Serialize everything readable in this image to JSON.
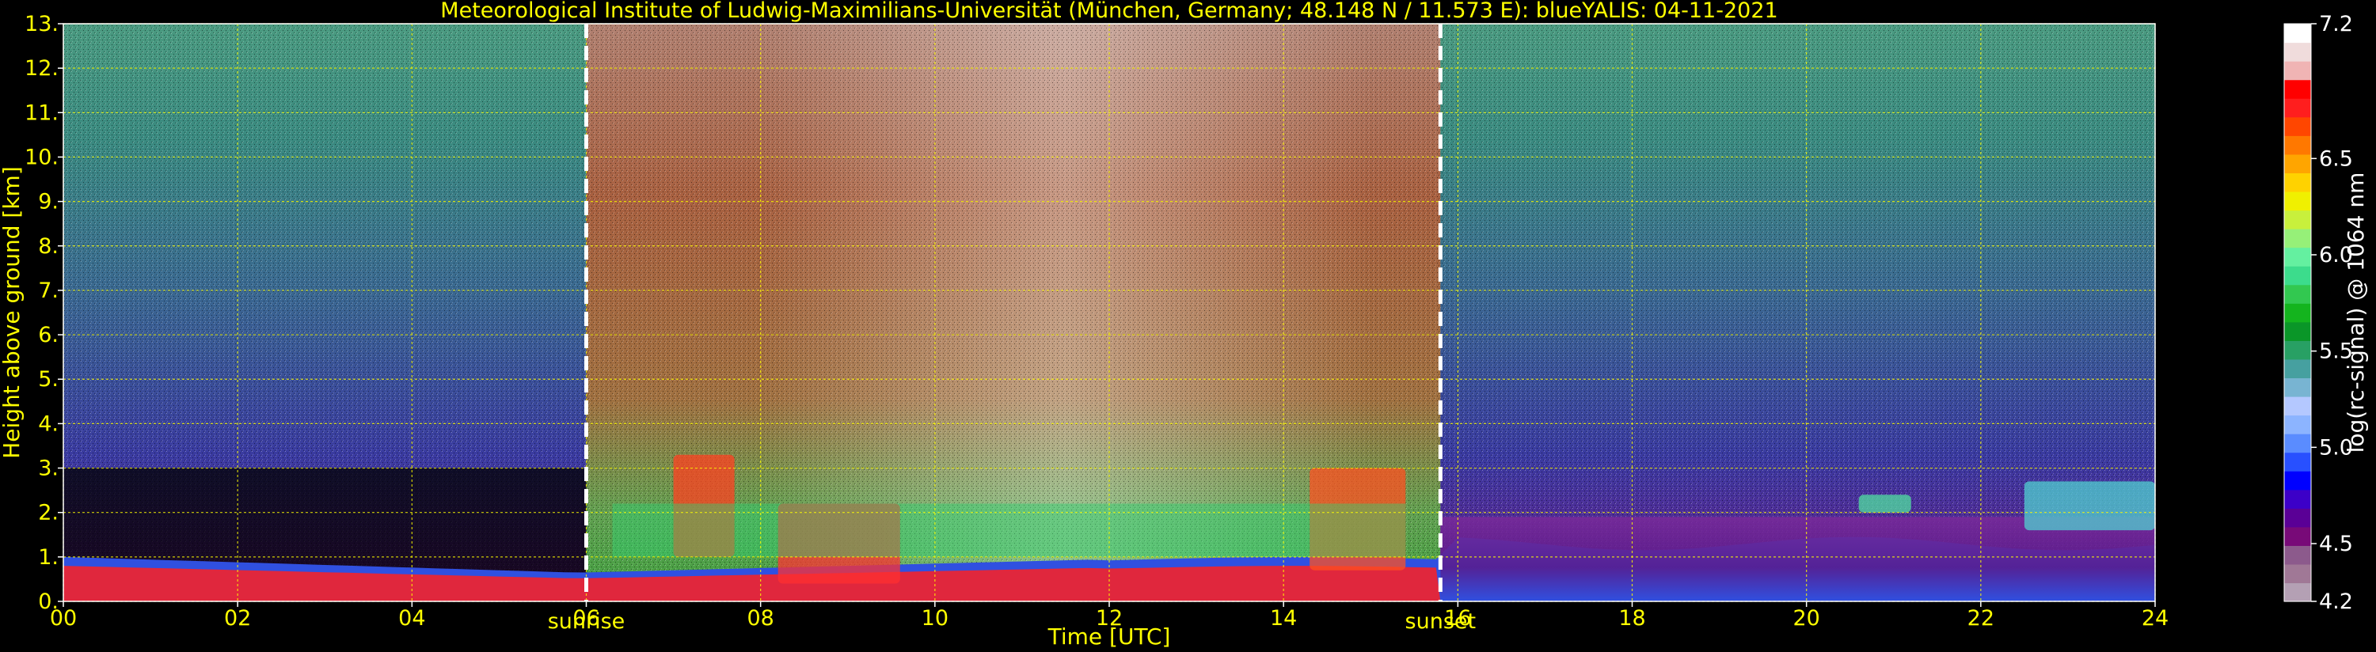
{
  "chart_data": {
    "type": "heatmap",
    "title": "Meteorological Institute of Ludwig-Maximilians-Universität (München, Germany; 48.148 N / 11.573 E):    blueYALIS: 04-11-2021",
    "xlabel": "Time [UTC]",
    "ylabel": "Height above ground [km]",
    "xlim": [
      0,
      24
    ],
    "ylim": [
      0,
      13
    ],
    "x_ticks": [
      "00",
      "02",
      "04",
      "06",
      "08",
      "10",
      "12",
      "14",
      "16",
      "18",
      "20",
      "22",
      "24"
    ],
    "y_ticks": [
      "0.",
      "1.",
      "2.",
      "3.",
      "4.",
      "5.",
      "6.",
      "7.",
      "8.",
      "9.",
      "10.",
      "11.",
      "12.",
      "13."
    ],
    "grid": true,
    "annotations": [
      {
        "label": "sunrise",
        "x": 6.0
      },
      {
        "label": "sunset",
        "x": 15.8
      }
    ],
    "colorbar": {
      "label": "log(rc-signal) @ 1064 nm",
      "range": [
        4.2,
        7.2
      ],
      "tick_labels": [
        "4.2",
        "4.5",
        "5.0",
        "5.5",
        "6.0",
        "6.5",
        "7.2"
      ],
      "tick_values": [
        4.2,
        4.5,
        5.0,
        5.5,
        6.0,
        6.5,
        7.2
      ],
      "colors": [
        "#b4a0b4",
        "#a07896",
        "#8c5a8c",
        "#780a78",
        "#5a0096",
        "#3c00c8",
        "#0000ff",
        "#2850ff",
        "#5a8cff",
        "#8cb4ff",
        "#b4c8ff",
        "#78b4d2",
        "#46a0a0",
        "#28a064",
        "#0a9628",
        "#14b41e",
        "#32c850",
        "#3cdc8c",
        "#64f0a0",
        "#96f078",
        "#c8f03c",
        "#f0f000",
        "#ffd200",
        "#ffa500",
        "#ff7800",
        "#ff4600",
        "#ff1e1e",
        "#ff0000",
        "#f0b4b4",
        "#f0dcdc",
        "#ffffff"
      ]
    }
  }
}
